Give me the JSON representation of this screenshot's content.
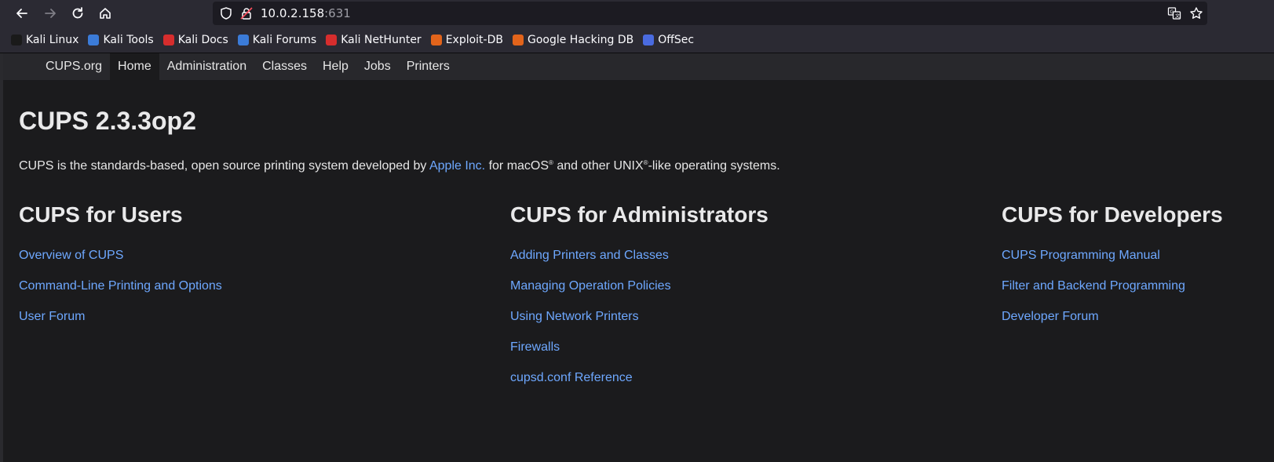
{
  "browser": {
    "url_host": "10.0.2.158",
    "url_port": ":631",
    "bookmarks": [
      {
        "label": "Kali Linux",
        "color": "#1a1a1a"
      },
      {
        "label": "Kali Tools",
        "color": "#3b7bd8"
      },
      {
        "label": "Kali Docs",
        "color": "#d62d2d"
      },
      {
        "label": "Kali Forums",
        "color": "#3b7bd8"
      },
      {
        "label": "Kali NetHunter",
        "color": "#d62d2d"
      },
      {
        "label": "Exploit-DB",
        "color": "#e2641b"
      },
      {
        "label": "Google Hacking DB",
        "color": "#e2641b"
      },
      {
        "label": "OffSec",
        "color": "#4a6be0"
      }
    ]
  },
  "cups_nav": {
    "items": [
      "CUPS.org",
      "Home",
      "Administration",
      "Classes",
      "Help",
      "Jobs",
      "Printers"
    ],
    "active": "Home"
  },
  "main": {
    "title": "CUPS 2.3.3op2",
    "intro_prefix": "CUPS is the standards-based, open source printing system developed by ",
    "intro_link": "Apple Inc.",
    "intro_mid": " for macOS",
    "intro_reg1": "®",
    "intro_mid2": " and other UNIX",
    "intro_reg2": "®",
    "intro_suffix": "-like operating systems."
  },
  "columns": [
    {
      "heading": "CUPS for Users",
      "links": [
        "Overview of CUPS",
        "Command-Line Printing and Options",
        "User Forum"
      ]
    },
    {
      "heading": "CUPS for Administrators",
      "links": [
        "Adding Printers and Classes",
        "Managing Operation Policies",
        "Using Network Printers",
        "Firewalls",
        "cupsd.conf Reference"
      ]
    },
    {
      "heading": "CUPS for Developers",
      "links": [
        "CUPS Programming Manual",
        "Filter and Backend Programming",
        "Developer Forum"
      ]
    }
  ],
  "colors": {
    "link": "#6ea8ff",
    "chrome": "#2b2a33",
    "page_bg": "#1b1b1d"
  }
}
